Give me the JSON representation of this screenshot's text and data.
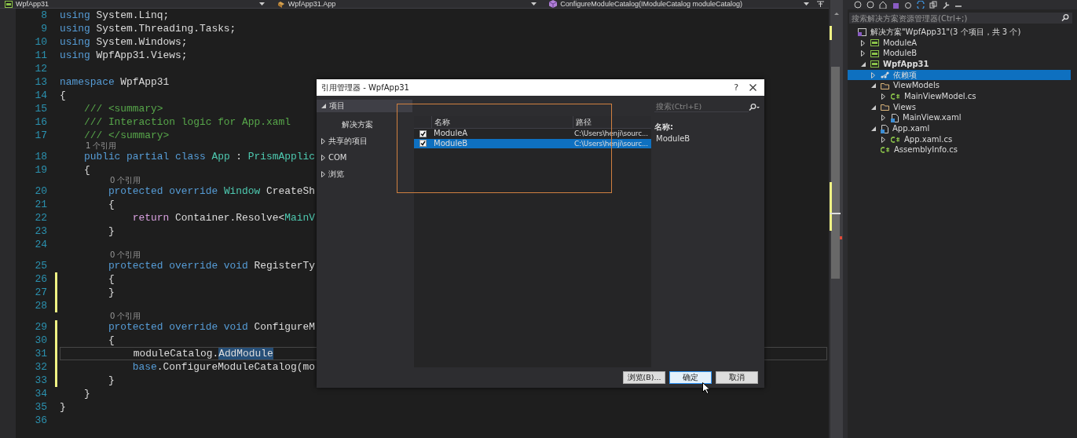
{
  "nav_bar": [
    {
      "label": "WpfApp31",
      "kind": "project"
    },
    {
      "label": "WpfApp31.App",
      "kind": "class"
    },
    {
      "label": "ConfigureModuleCatalog(IModuleCatalog moduleCatalog)",
      "kind": "method"
    }
  ],
  "editor": {
    "lines": [
      {
        "n": "8",
        "modified": false,
        "current": false,
        "tokens": [
          {
            "text": "using",
            "kind": "kw"
          },
          {
            "text": " System.Linq;",
            "kind": "plain"
          }
        ]
      },
      {
        "n": "9",
        "modified": false,
        "current": false,
        "tokens": [
          {
            "text": "using",
            "kind": "kw"
          },
          {
            "text": " System.Threading.Tasks;",
            "kind": "plain"
          }
        ]
      },
      {
        "n": "10",
        "modified": false,
        "current": false,
        "tokens": [
          {
            "text": "using",
            "kind": "kw"
          },
          {
            "text": " System.Windows;",
            "kind": "plain"
          }
        ]
      },
      {
        "n": "11",
        "modified": false,
        "current": false,
        "tokens": [
          {
            "text": "using",
            "kind": "kw"
          },
          {
            "text": " WpfApp31.Views;",
            "kind": "plain"
          }
        ]
      },
      {
        "n": "12",
        "modified": false,
        "current": false
      },
      {
        "n": "13",
        "modified": false,
        "current": false,
        "tokens": [
          {
            "text": "namespace",
            "kind": "kw"
          },
          {
            "text": " WpfApp31",
            "kind": "plain"
          }
        ]
      },
      {
        "n": "14",
        "modified": false,
        "current": false,
        "tokens": [
          {
            "text": "{",
            "kind": "plain"
          }
        ]
      },
      {
        "n": "15",
        "modified": false,
        "current": false,
        "tokens": [
          {
            "text": "    /// <summary>",
            "kind": "comment"
          }
        ]
      },
      {
        "n": "16",
        "modified": false,
        "current": false,
        "tokens": [
          {
            "text": "    /// Interaction logic for App.xaml",
            "kind": "comment"
          }
        ]
      },
      {
        "n": "17",
        "modified": false,
        "current": false,
        "tokens": [
          {
            "text": "    /// </summary>",
            "kind": "comment"
          }
        ]
      },
      {
        "n": "18",
        "modified": false,
        "current": false,
        "codelens": "1 个引用",
        "tokens": [
          {
            "text": "    public partial class ",
            "kind": "kw"
          },
          {
            "text": "App",
            "kind": "type"
          },
          {
            "text": " : ",
            "kind": "plain"
          },
          {
            "text": "PrismApplic",
            "kind": "type"
          }
        ]
      },
      {
        "n": "19",
        "modified": false,
        "current": false,
        "tokens": [
          {
            "text": "    {",
            "kind": "plain"
          }
        ]
      },
      {
        "n": "20",
        "modified": false,
        "current": false,
        "codelens": "0 个引用",
        "tokens": [
          {
            "text": "        protected override ",
            "kind": "kw"
          },
          {
            "text": "Window",
            "kind": "type"
          },
          {
            "text": " CreateSh",
            "kind": "plain"
          }
        ]
      },
      {
        "n": "21",
        "modified": false,
        "current": false,
        "tokens": [
          {
            "text": "        {",
            "kind": "plain"
          }
        ]
      },
      {
        "n": "22",
        "modified": false,
        "current": false,
        "tokens": [
          {
            "text": "            return",
            "kind": "control"
          },
          {
            "text": " Container.Resolve<",
            "kind": "plain"
          },
          {
            "text": "MainV",
            "kind": "type"
          }
        ]
      },
      {
        "n": "23",
        "modified": false,
        "current": false,
        "tokens": [
          {
            "text": "        }",
            "kind": "plain"
          }
        ]
      },
      {
        "n": "24",
        "modified": false,
        "current": false
      },
      {
        "n": "25",
        "modified": false,
        "current": false,
        "codelens": "0 个引用",
        "tokens": [
          {
            "text": "        protected override void",
            "kind": "kw"
          },
          {
            "text": " RegisterTy",
            "kind": "plain"
          }
        ]
      },
      {
        "n": "26",
        "modified": true,
        "current": false,
        "tokens": [
          {
            "text": "        {",
            "kind": "plain"
          }
        ]
      },
      {
        "n": "27",
        "modified": true,
        "current": false,
        "tokens": [
          {
            "text": "        }",
            "kind": "plain"
          }
        ]
      },
      {
        "n": "28",
        "modified": true,
        "current": false
      },
      {
        "n": "29",
        "modified": true,
        "current": false,
        "codelens": "0 个引用",
        "tokens": [
          {
            "text": "        protected override void",
            "kind": "kw"
          },
          {
            "text": " ConfigureM",
            "kind": "plain"
          }
        ]
      },
      {
        "n": "30",
        "modified": true,
        "current": false,
        "tokens": [
          {
            "text": "        {",
            "kind": "plain"
          }
        ]
      },
      {
        "n": "31",
        "modified": true,
        "current": true,
        "tokens": [
          {
            "text": "            moduleCatalog.",
            "kind": "plain"
          },
          {
            "text": "AddModule",
            "kind": "selection"
          }
        ]
      },
      {
        "n": "32",
        "modified": true,
        "current": false,
        "tokens": [
          {
            "text": "            base",
            "kind": "kw"
          },
          {
            "text": ".ConfigureModuleCatalog(mo",
            "kind": "plain"
          }
        ]
      },
      {
        "n": "33",
        "modified": true,
        "current": false,
        "tokens": [
          {
            "text": "        }",
            "kind": "plain"
          }
        ]
      },
      {
        "n": "34",
        "modified": false,
        "current": false,
        "tokens": [
          {
            "text": "    }",
            "kind": "plain"
          }
        ]
      },
      {
        "n": "35",
        "modified": false,
        "current": false,
        "tokens": [
          {
            "text": "}",
            "kind": "plain"
          }
        ]
      },
      {
        "n": "36",
        "modified": false,
        "current": false
      }
    ]
  },
  "dialog": {
    "title": "引用管理器 - WpfApp31",
    "help": "?",
    "nav": [
      {
        "label": "项目",
        "expanded": true,
        "selected": true,
        "children": [
          {
            "label": "解决方案",
            "selected": false
          }
        ]
      },
      {
        "label": "共享的项目",
        "expanded": false,
        "selected": false
      },
      {
        "label": "COM",
        "expanded": false,
        "selected": false
      },
      {
        "label": "浏览",
        "expanded": false,
        "selected": false
      }
    ],
    "search": {
      "placeholder": "搜索(Ctrl+E)"
    },
    "table": {
      "columns": [
        "名称",
        "路径"
      ],
      "rows": [
        {
          "checked": true,
          "selected": false,
          "name": "ModuleA",
          "path": "C:\\Users\\henji\\sourc..."
        },
        {
          "checked": true,
          "selected": true,
          "name": "ModuleB",
          "path": "C:\\Users\\henji\\sourc..."
        }
      ]
    },
    "details": {
      "label": "名称:",
      "value": "ModuleB"
    },
    "buttons": [
      {
        "label": "浏览(B)...",
        "focused": false
      },
      {
        "label": "确定",
        "focused": true
      },
      {
        "label": "取消",
        "focused": false
      }
    ]
  },
  "solution_explorer": {
    "search": {
      "placeholder": "搜索解决方案资源管理器(Ctrl+;)"
    },
    "tree": [
      {
        "label": "解决方案\"WpfApp31\"(3 个项目，共 3 个)",
        "kind": "solution",
        "startup": false,
        "selected": false,
        "children": [
          {
            "label": "ModuleA",
            "kind": "csproj",
            "expanded": false,
            "startup": false,
            "selected": false
          },
          {
            "label": "ModuleB",
            "kind": "csproj",
            "expanded": false,
            "startup": false,
            "selected": false
          },
          {
            "label": "WpfApp31",
            "kind": "csproj",
            "expanded": true,
            "startup": true,
            "selected": false,
            "children": [
              {
                "label": "依赖项",
                "kind": "dependencies",
                "expanded": false,
                "startup": false,
                "selected": true
              },
              {
                "label": "ViewModels",
                "kind": "folder",
                "expanded": true,
                "startup": false,
                "selected": false,
                "children": [
                  {
                    "label": "MainViewModel.cs",
                    "kind": "cs",
                    "expanded": false,
                    "startup": false,
                    "selected": false
                  }
                ]
              },
              {
                "label": "Views",
                "kind": "folder",
                "expanded": true,
                "startup": false,
                "selected": false,
                "children": [
                  {
                    "label": "MainView.xaml",
                    "kind": "xaml",
                    "expanded": false,
                    "startup": false,
                    "selected": false
                  }
                ]
              },
              {
                "label": "App.xaml",
                "kind": "xaml",
                "expanded": true,
                "startup": false,
                "selected": false,
                "children": [
                  {
                    "label": "App.xaml.cs",
                    "kind": "cs",
                    "expanded": false,
                    "startup": false,
                    "selected": false
                  }
                ]
              },
              {
                "label": "AssemblyInfo.cs",
                "kind": "cs",
                "startup": false,
                "selected": false
              }
            ]
          }
        ]
      }
    ]
  }
}
